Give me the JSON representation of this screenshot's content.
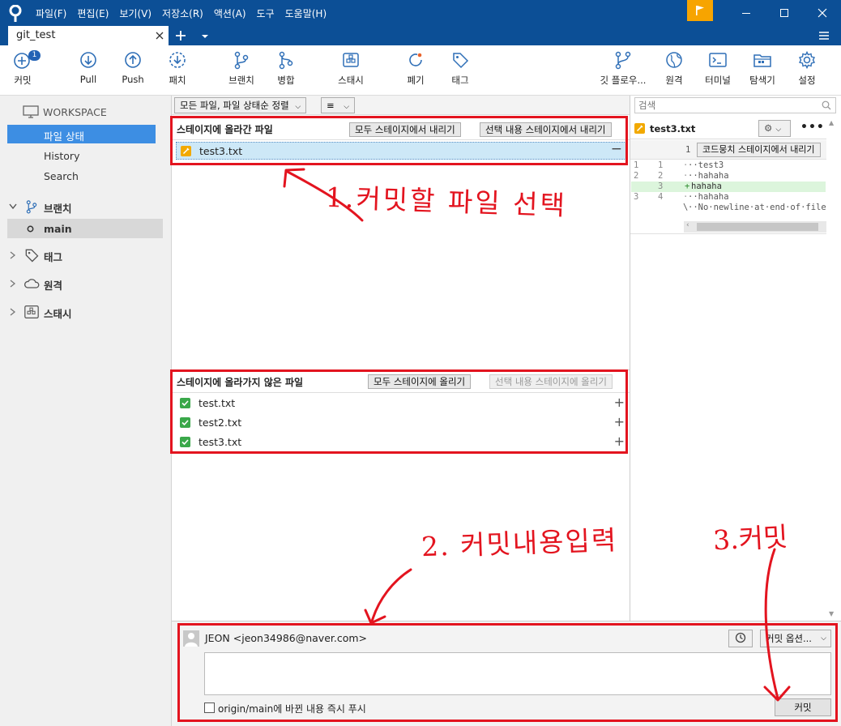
{
  "menu": [
    "파일(F)",
    "편집(E)",
    "보기(V)",
    "저장소(R)",
    "액션(A)",
    "도구",
    "도움말(H)"
  ],
  "tab": {
    "title": "git_test"
  },
  "toolbar": {
    "commit": "커밋",
    "commit_badge": "1",
    "pull": "Pull",
    "push": "Push",
    "patch": "패치",
    "branch": "브랜치",
    "merge": "병합",
    "stash": "스태시",
    "discard": "폐기",
    "tag": "태그",
    "gitflow": "깃 플로우...",
    "remote": "원격",
    "terminal": "터미널",
    "explorer": "탐색기",
    "settings": "설정"
  },
  "sidebar": {
    "workspace": "WORKSPACE",
    "file_status": "파일 상태",
    "history": "History",
    "search": "Search",
    "branches": "브랜치",
    "main": "main",
    "tags": "태그",
    "remotes": "원격",
    "stashes": "스태시"
  },
  "filter": {
    "sort": "모든 파일, 파일 상태순 정렬"
  },
  "staged": {
    "title": "스테이지에 올라간 파일",
    "unstage_all": "모두 스테이지에서 내리기",
    "unstage_sel": "선택 내용 스테이지에서 내리기",
    "files": [
      "test3.txt"
    ]
  },
  "unstaged": {
    "title": "스테이지에 올라가지 않은 파일",
    "stage_all": "모두 스테이지에 올리기",
    "stage_sel": "선택 내용 스테이지에 올리기",
    "files": [
      "test.txt",
      "test2.txt",
      "test3.txt"
    ]
  },
  "diff": {
    "search_placeholder": "검색",
    "file": "test3.txt",
    "hunk_btn": "코드뭉치 스테이지에서 내리기",
    "hunk_num": "1",
    "lines": [
      {
        "o": "1",
        "n": "1",
        "m": "·",
        "t": "··test3"
      },
      {
        "o": "2",
        "n": "2",
        "m": "·",
        "t": "··hahaha"
      },
      {
        "o": "",
        "n": "3",
        "m": "+",
        "t": " hahaha"
      },
      {
        "o": "3",
        "n": "4",
        "m": "·",
        "t": "··hahaha"
      },
      {
        "o": "",
        "n": "",
        "m": "\\",
        "t": "··No·newline·at·end·of·file"
      }
    ]
  },
  "commit": {
    "author": "JEON <jeon34986@naver.com>",
    "options": "커밋 옵션...",
    "push_label": "origin/main에 바뀐 내용 즉시 푸시",
    "commit_btn": "커밋"
  },
  "annotations": {
    "a1": "1.커밋할 파일 선택",
    "a2": "2. 커밋내용입력",
    "a3": "3.커밋"
  },
  "colors": {
    "titlebar": "#0c4f96",
    "selection": "#3d8ee3",
    "annotation": "#e3141f",
    "stage_green": "#3aa84a"
  }
}
